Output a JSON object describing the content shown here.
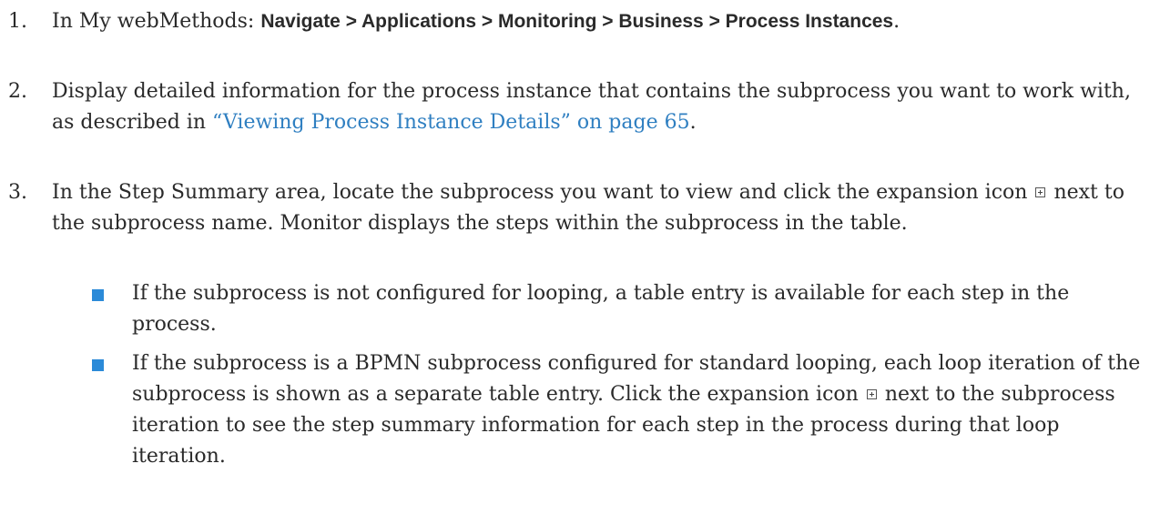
{
  "steps": [
    {
      "number": "1.",
      "intro": "In My webMethods: ",
      "path": "Navigate > Applications > Monitoring > Business > Process Instances",
      "end": "."
    },
    {
      "number": "2.",
      "text_before": "Display detailed information for the process instance that contains the subprocess you want to work with, as described in ",
      "link": "“Viewing Process Instance Details” on page 65",
      "text_after": "."
    },
    {
      "number": "3.",
      "text_before": "In the Step Summary area, locate the subprocess you want to view and click the expansion icon ",
      "text_after": " next to the subprocess name. Monitor displays the steps within the subprocess in the table."
    }
  ],
  "bullets": [
    {
      "text": "If the subprocess is not configured for looping, a table entry is available for each step in the process."
    },
    {
      "text_before": "If the subprocess is a BPMN subprocess configured for standard looping, each loop iteration of the subprocess is shown as a separate table entry. Click the expansion icon ",
      "text_after": " next to the subprocess iteration to see the step summary information for each step in the process during that loop iteration."
    }
  ],
  "icons": {
    "expand": "expand-plus-icon",
    "bullet": "square-bullet"
  },
  "colors": {
    "link": "#2f7fc1",
    "bullet": "#2b8ad8",
    "text": "#2a2a2a"
  }
}
